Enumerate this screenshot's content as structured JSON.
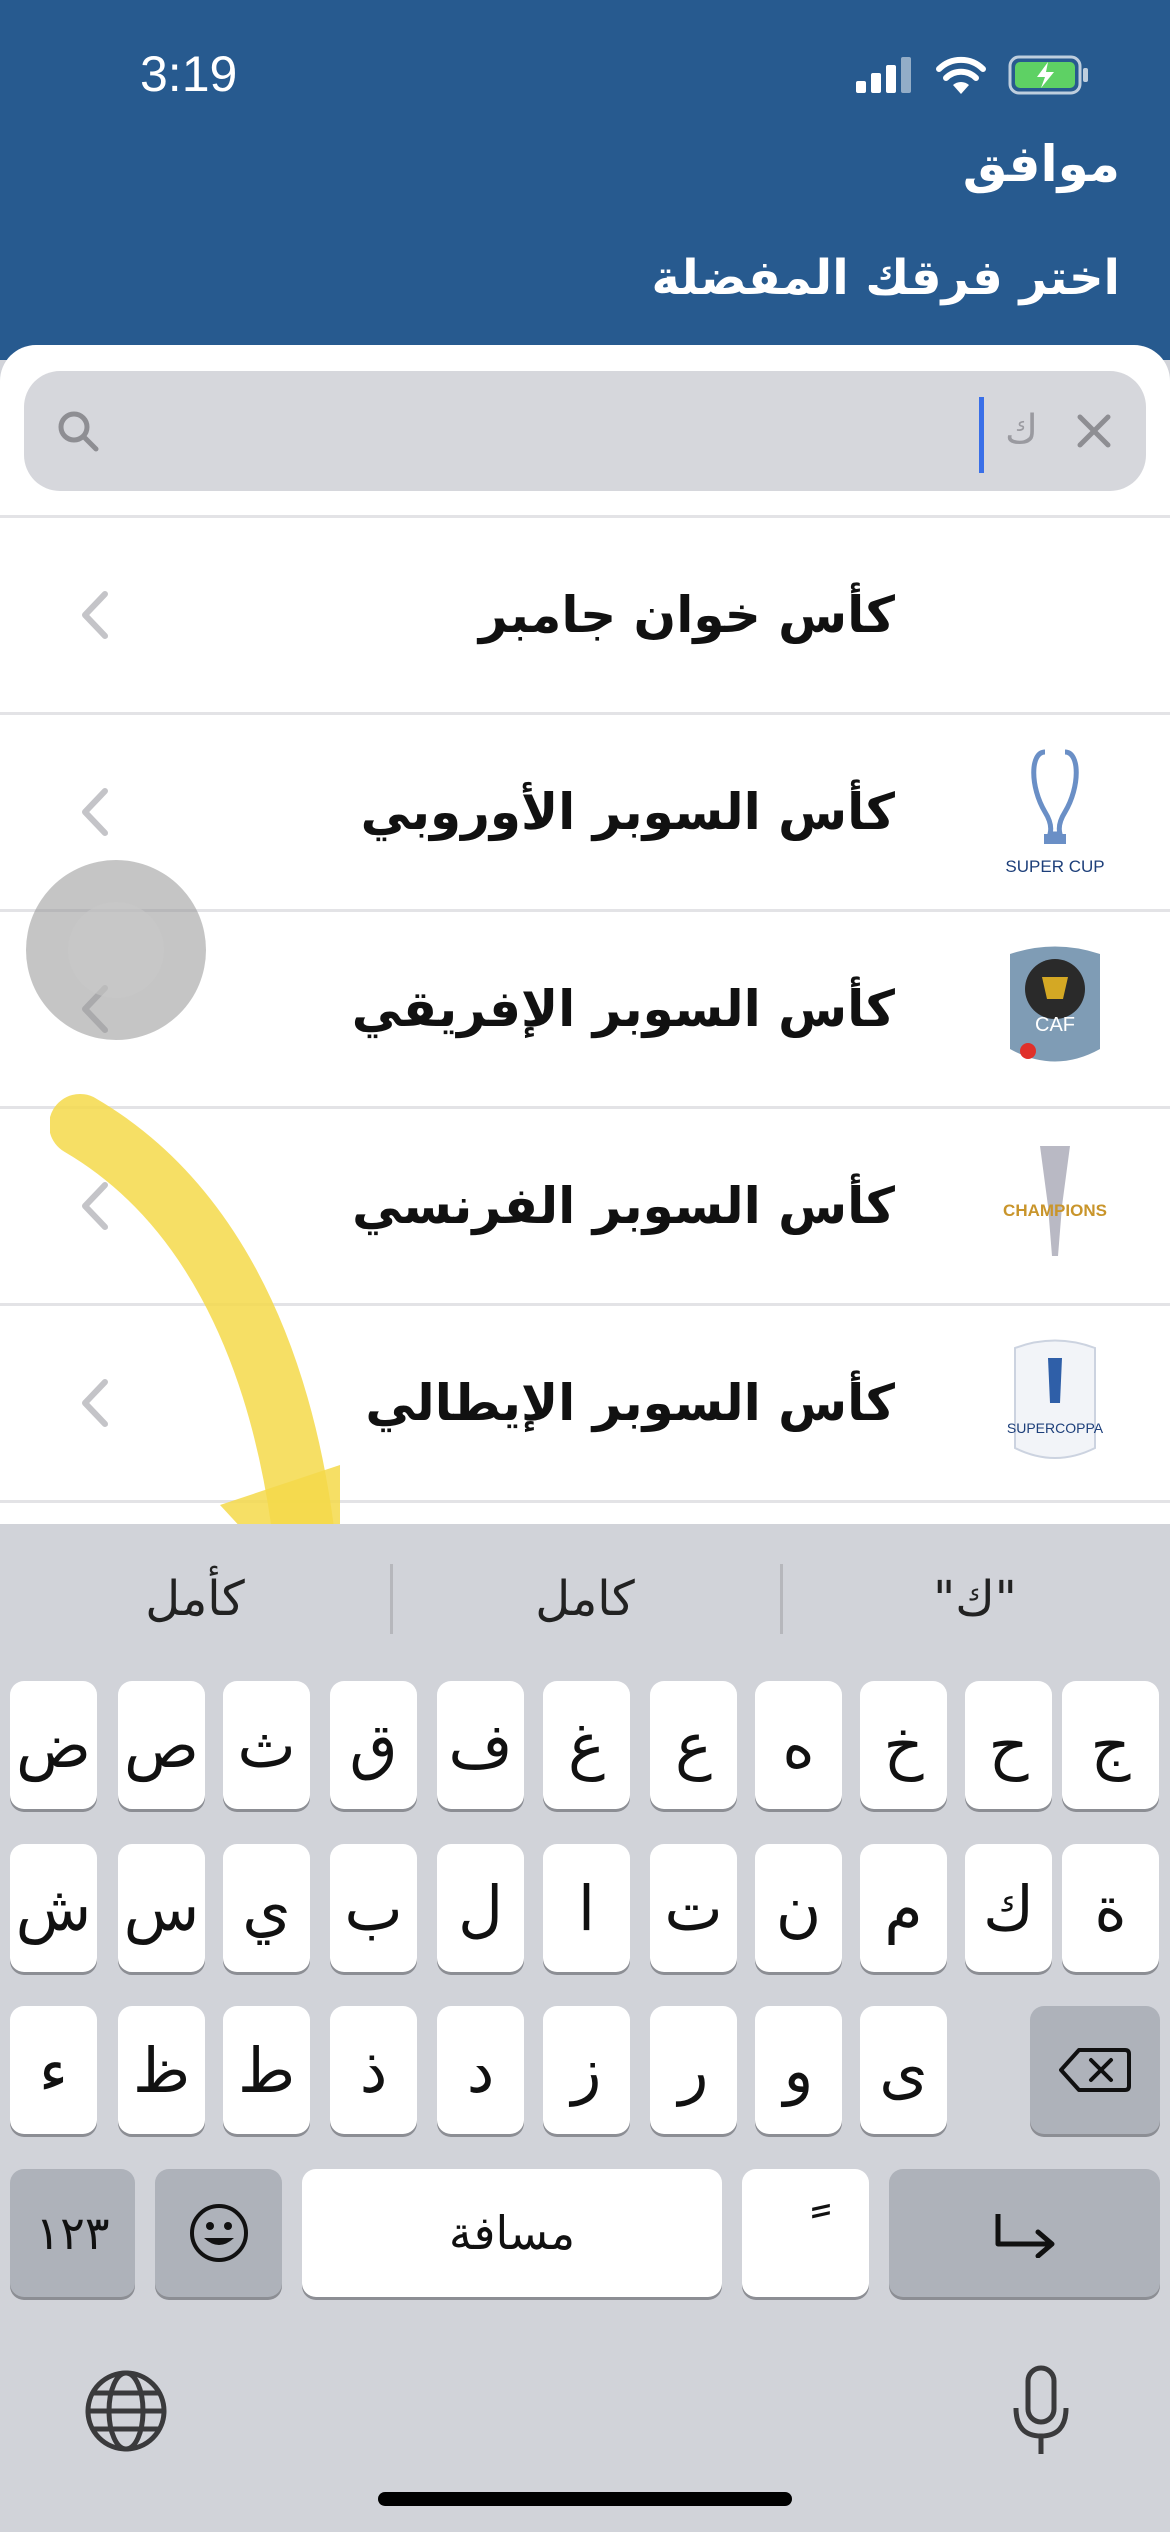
{
  "status": {
    "time": "3:19"
  },
  "header": {
    "ok_label": "موافق",
    "title": "اختر فرقك المفضلة"
  },
  "search": {
    "typed": "ك"
  },
  "rows": [
    {
      "label": "كأس خوان جامبر",
      "logo": "none"
    },
    {
      "label": "كأس السوبر الأوروبي",
      "logo": "uefa-super-cup-logo",
      "logo_text": "SUPER CUP"
    },
    {
      "label": "كأس السوبر الإفريقي",
      "logo": "caf-super-cup-logo",
      "logo_text": "CAF"
    },
    {
      "label": "كأس السوبر الفرنسي",
      "logo": "trophee-des-champions-logo",
      "logo_text": "CHAMPIONS"
    },
    {
      "label": "كأس السوبر الإيطالي",
      "logo": "supercoppa-logo",
      "logo_text": "SUPERCOPPA"
    },
    {
      "label": "",
      "logo": "trophy-logo"
    }
  ],
  "keyboard": {
    "suggestions": [
      "\"ك\"",
      "كامل",
      "كأمل"
    ],
    "row1": [
      "ج",
      "ح",
      "خ",
      "ه",
      "ع",
      "غ",
      "ف",
      "ق",
      "ث",
      "ص",
      "ض"
    ],
    "row2": [
      "ة",
      "ك",
      "م",
      "ن",
      "ت",
      "ا",
      "ل",
      "ب",
      "ي",
      "س",
      "ش"
    ],
    "row3": [
      "ى",
      "و",
      "ر",
      "ز",
      "د",
      "ذ",
      "ط",
      "ظ",
      "ء"
    ],
    "numbers_label": "١٢٣",
    "space_label": "مسافة",
    "tanween_label": "ً"
  },
  "colors": {
    "header": "#275a8f",
    "accent": "#3a6fe8",
    "annotation_arrow": "#f5d94a"
  }
}
